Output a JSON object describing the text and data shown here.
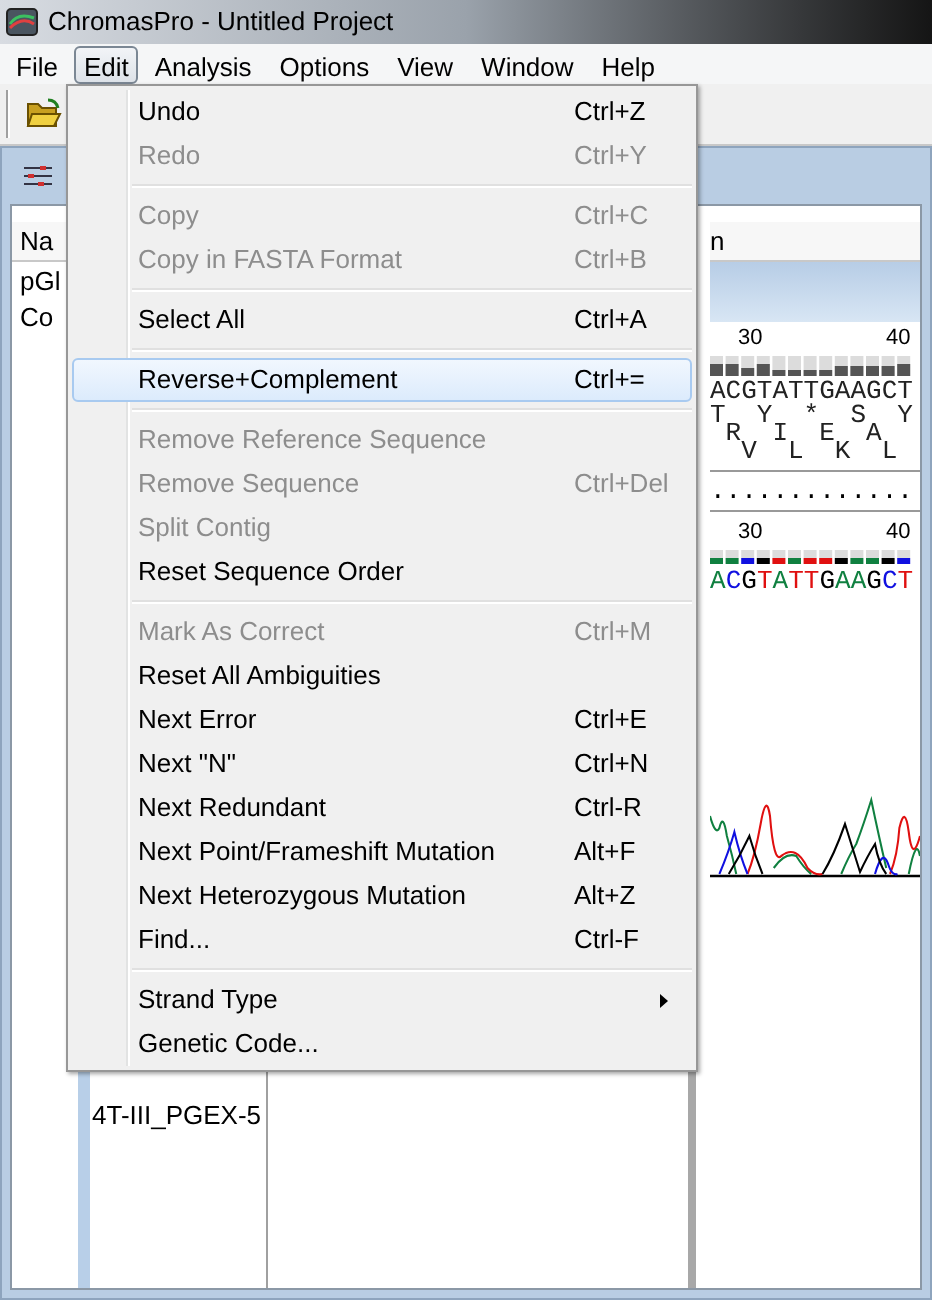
{
  "window": {
    "title": "ChromasPro - Untitled Project"
  },
  "menu_bar": [
    {
      "label": "File",
      "selected": false
    },
    {
      "label": "Edit",
      "selected": true
    },
    {
      "label": "Analysis",
      "selected": false
    },
    {
      "label": "Options",
      "selected": false
    },
    {
      "label": "View",
      "selected": false
    },
    {
      "label": "Window",
      "selected": false
    },
    {
      "label": "Help",
      "selected": false
    }
  ],
  "edit_menu": [
    {
      "kind": "item",
      "label": "Undo",
      "shortcut": "Ctrl+Z",
      "disabled": false,
      "selected": false
    },
    {
      "kind": "item",
      "label": "Redo",
      "shortcut": "Ctrl+Y",
      "disabled": true,
      "selected": false
    },
    {
      "kind": "separator"
    },
    {
      "kind": "item",
      "label": "Copy",
      "shortcut": "Ctrl+C",
      "disabled": true,
      "selected": false
    },
    {
      "kind": "item",
      "label": "Copy in FASTA Format",
      "shortcut": "Ctrl+B",
      "disabled": true,
      "selected": false
    },
    {
      "kind": "separator"
    },
    {
      "kind": "item",
      "label": "Select All",
      "shortcut": "Ctrl+A",
      "disabled": false,
      "selected": false
    },
    {
      "kind": "separator"
    },
    {
      "kind": "item",
      "label": "Reverse+Complement",
      "shortcut": "Ctrl+=",
      "disabled": false,
      "selected": true
    },
    {
      "kind": "separator"
    },
    {
      "kind": "item",
      "label": "Remove Reference Sequence",
      "disabled": true,
      "selected": false
    },
    {
      "kind": "item",
      "label": "Remove Sequence",
      "shortcut": "Ctrl+Del",
      "disabled": true,
      "selected": false
    },
    {
      "kind": "item",
      "label": "Split Contig",
      "disabled": true,
      "selected": false
    },
    {
      "kind": "item",
      "label": "Reset Sequence Order",
      "disabled": false,
      "selected": false
    },
    {
      "kind": "separator"
    },
    {
      "kind": "item",
      "label": "Mark As Correct",
      "shortcut": "Ctrl+M",
      "disabled": true,
      "selected": false
    },
    {
      "kind": "item",
      "label": "Reset All Ambiguities",
      "disabled": false,
      "selected": false
    },
    {
      "kind": "item",
      "label": "Next Error",
      "shortcut": "Ctrl+E",
      "disabled": false,
      "selected": false
    },
    {
      "kind": "item",
      "label": "Next \"N\"",
      "shortcut": "Ctrl+N",
      "disabled": false,
      "selected": false
    },
    {
      "kind": "item",
      "label": "Next Redundant",
      "shortcut": "Ctrl-R",
      "disabled": false,
      "selected": false
    },
    {
      "kind": "item",
      "label": "Next Point/Frameshift Mutation",
      "shortcut": "Alt+F",
      "disabled": false,
      "selected": false
    },
    {
      "kind": "item",
      "label": "Next Heterozygous Mutation",
      "shortcut": "Alt+Z",
      "disabled": false,
      "selected": false
    },
    {
      "kind": "item",
      "label": "Find...",
      "shortcut": "Ctrl-F",
      "disabled": false,
      "selected": false
    },
    {
      "kind": "separator"
    },
    {
      "kind": "submenu",
      "label": "Strand Type",
      "disabled": false,
      "selected": false
    },
    {
      "kind": "item",
      "label": "Genetic Code...",
      "disabled": false,
      "selected": false
    }
  ],
  "project_list": {
    "column_1": "Na",
    "rows": [
      "pGl",
      "Co"
    ],
    "bottom_entry": "4T-III_PGEX-5"
  },
  "contig_view": {
    "column_2": "n",
    "ruler_1": [
      "30",
      "40"
    ],
    "sequence_1": "ACGTATTGAAGCT",
    "translation": [
      "T  Y  *  S  Y",
      " R  I  E  A",
      "  V  L  K  L"
    ],
    "consensus": ".............",
    "ruler_2": [
      "30",
      "40"
    ],
    "sequence_2": "ACGTATTGAAGCT"
  }
}
